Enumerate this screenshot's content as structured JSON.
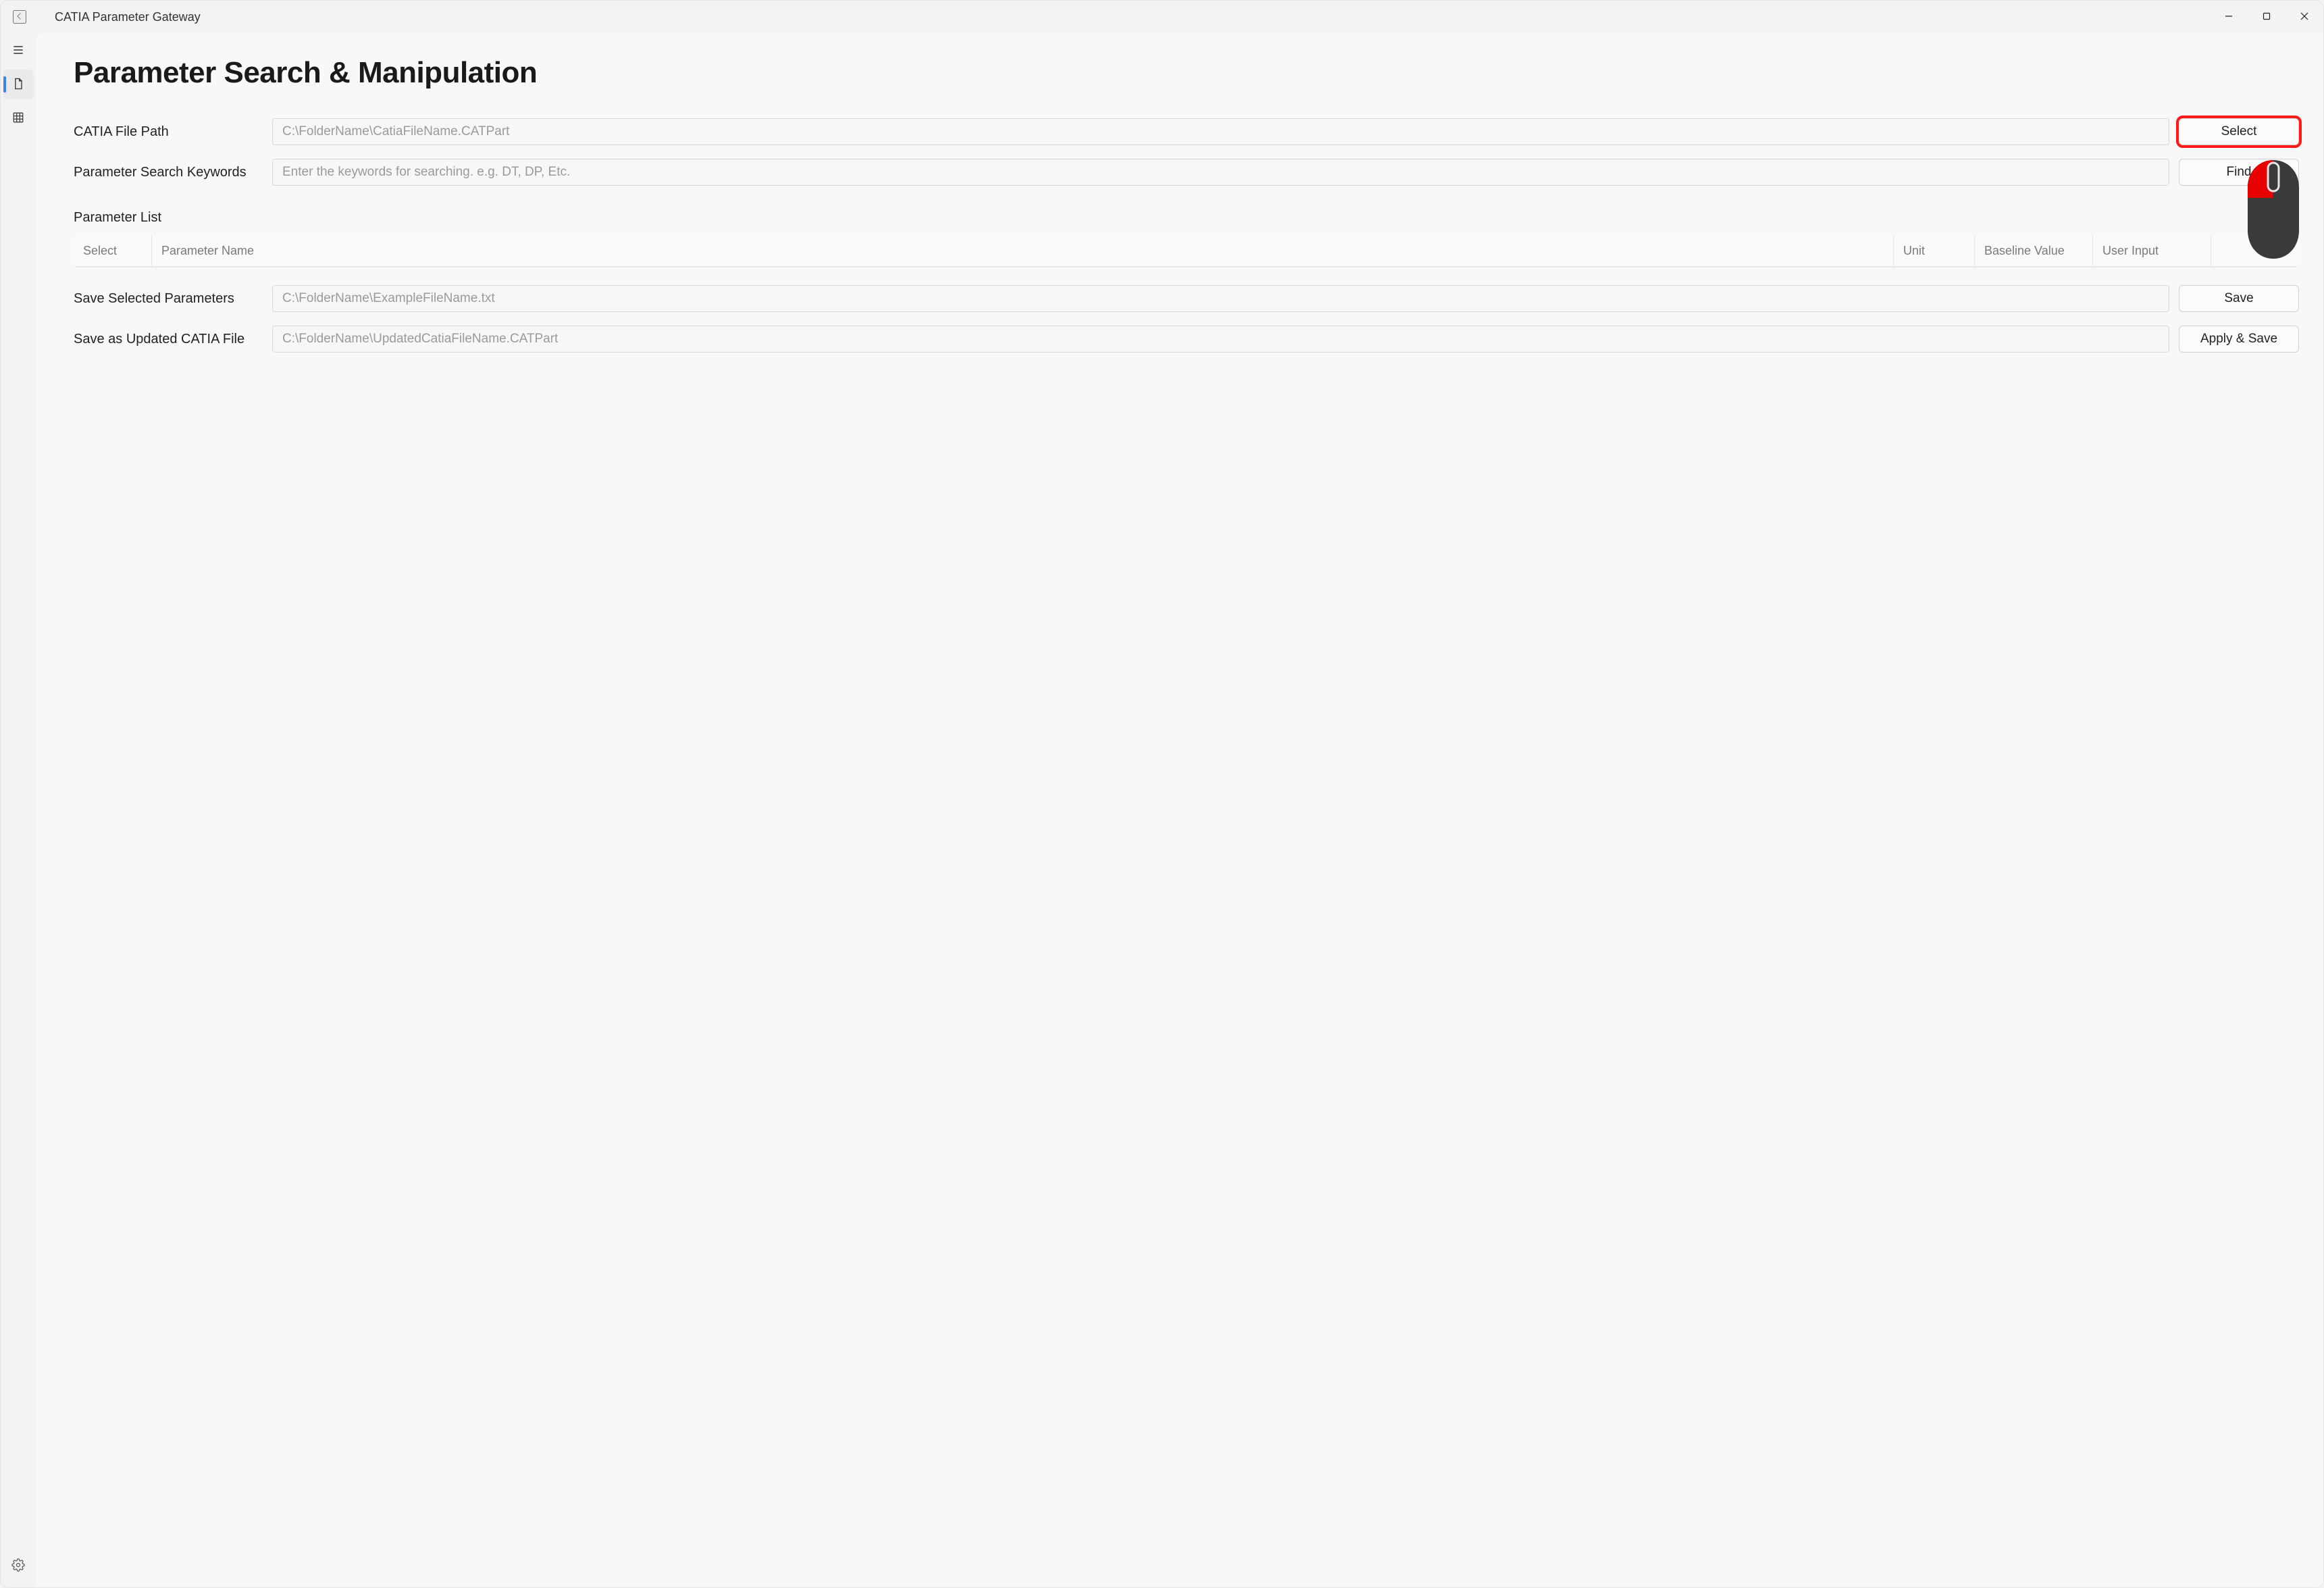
{
  "window": {
    "title": "CATIA Parameter Gateway"
  },
  "page": {
    "title": "Parameter Search & Manipulation"
  },
  "rows": {
    "catia_path": {
      "label": "CATIA File Path",
      "placeholder": "C:\\FolderName\\CatiaFileName.CATPart",
      "button": "Select"
    },
    "keywords": {
      "label": "Parameter Search Keywords",
      "placeholder": "Enter the keywords for searching. e.g. DT, DP, Etc.",
      "button": "Find"
    },
    "save_sel": {
      "label": "Save Selected Parameters",
      "placeholder": "C:\\FolderName\\ExampleFileName.txt",
      "button": "Save"
    },
    "save_updated": {
      "label": "Save as Updated CATIA File",
      "placeholder": "C:\\FolderName\\UpdatedCatiaFileName.CATPart",
      "button": "Apply & Save"
    }
  },
  "list": {
    "heading": "Parameter List",
    "columns": {
      "select": "Select",
      "name": "Parameter Name",
      "unit": "Unit",
      "baseline": "Baseline Value",
      "user_input": "User Input"
    }
  },
  "highlight": {
    "select_button": true
  }
}
